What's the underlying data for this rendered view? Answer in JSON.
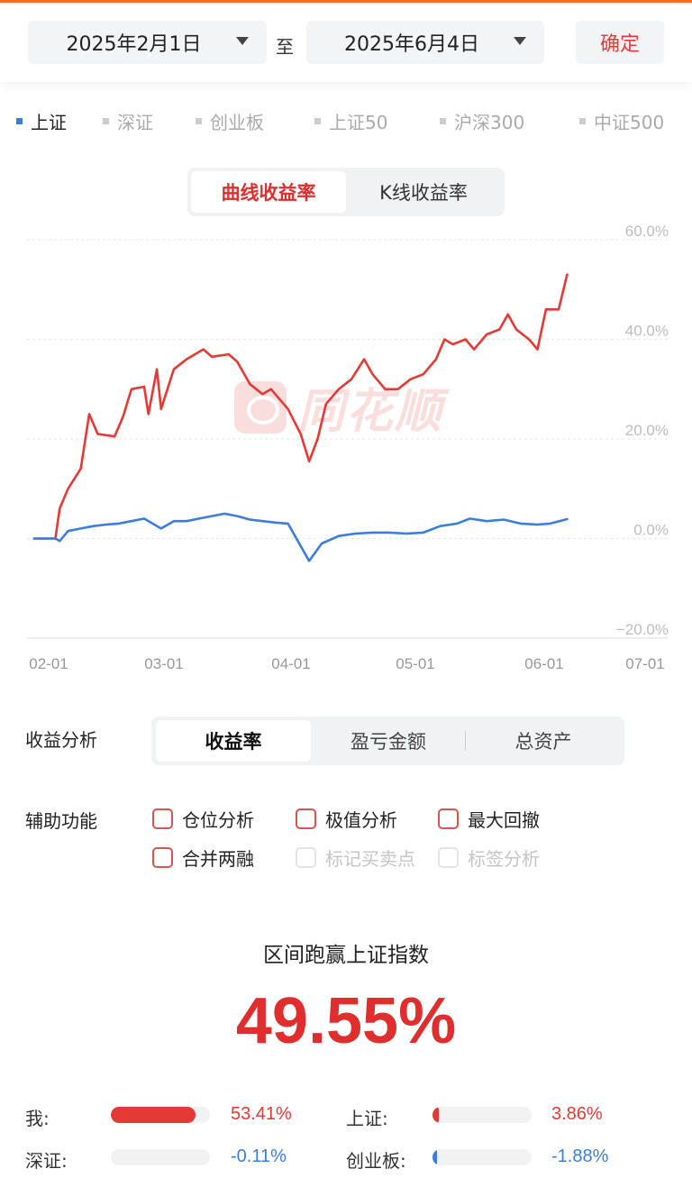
{
  "date_filter": {
    "start_date": "2025年2月1日",
    "separator": "至",
    "end_date": "2025年6月4日",
    "confirm_label": "确定"
  },
  "index_legend": [
    {
      "label": "上证",
      "active": true
    },
    {
      "label": "深证",
      "active": false
    },
    {
      "label": "创业板",
      "active": false
    },
    {
      "label": "上证50",
      "active": false
    },
    {
      "label": "沪深300",
      "active": false
    },
    {
      "label": "中证500",
      "active": false
    }
  ],
  "chart_mode": {
    "options": [
      "曲线收益率",
      "K线收益率"
    ],
    "selected": "曲线收益率"
  },
  "watermark_text": "同花顺",
  "chart_data": {
    "type": "line",
    "x_ticks": [
      "02-01",
      "03-01",
      "04-01",
      "05-01",
      "06-01",
      "07-01"
    ],
    "y_ticks": [
      "60.0%",
      "40.0%",
      "20.0%",
      "0.0%",
      "-20.0%"
    ],
    "ylim": [
      -20,
      60
    ],
    "grid": true,
    "series": [
      {
        "color": "#e53935",
        "points": [
          [
            "2025-02-01",
            0
          ],
          [
            "2025-02-06",
            0
          ],
          [
            "2025-02-07",
            6
          ],
          [
            "2025-02-09",
            10
          ],
          [
            "2025-02-12",
            14
          ],
          [
            "2025-02-14",
            25
          ],
          [
            "2025-02-16",
            21
          ],
          [
            "2025-02-20",
            20.5
          ],
          [
            "2025-02-22",
            24.5
          ],
          [
            "2025-02-24",
            30
          ],
          [
            "2025-02-27",
            30.5
          ],
          [
            "2025-02-28",
            25
          ],
          [
            "2025-03-02",
            34
          ],
          [
            "2025-03-03",
            26
          ],
          [
            "2025-03-06",
            34
          ],
          [
            "2025-03-09",
            36
          ],
          [
            "2025-03-11",
            37
          ],
          [
            "2025-03-13",
            38
          ],
          [
            "2025-03-15",
            36.5
          ],
          [
            "2025-03-19",
            37
          ],
          [
            "2025-03-21",
            35.5
          ],
          [
            "2025-03-24",
            31
          ],
          [
            "2025-03-27",
            29
          ],
          [
            "2025-03-29",
            30
          ],
          [
            "2025-03-31",
            28
          ],
          [
            "2025-04-02",
            26
          ],
          [
            "2025-04-05",
            21
          ],
          [
            "2025-04-07",
            15.5
          ],
          [
            "2025-04-09",
            20
          ],
          [
            "2025-04-11",
            27
          ],
          [
            "2025-04-14",
            30
          ],
          [
            "2025-04-17",
            32
          ],
          [
            "2025-04-20",
            36
          ],
          [
            "2025-04-22",
            33
          ],
          [
            "2025-04-25",
            30
          ],
          [
            "2025-04-28",
            30
          ],
          [
            "2025-05-01",
            32
          ],
          [
            "2025-05-04",
            33
          ],
          [
            "2025-05-07",
            36
          ],
          [
            "2025-05-09",
            40
          ],
          [
            "2025-05-11",
            39
          ],
          [
            "2025-05-14",
            40
          ],
          [
            "2025-05-16",
            38
          ],
          [
            "2025-05-19",
            41
          ],
          [
            "2025-05-22",
            42
          ],
          [
            "2025-05-24",
            45
          ],
          [
            "2025-05-26",
            42
          ],
          [
            "2025-05-29",
            40
          ],
          [
            "2025-05-31",
            38
          ],
          [
            "2025-06-02",
            46
          ],
          [
            "2025-06-05",
            46
          ],
          [
            "2025-06-07",
            53
          ]
        ]
      },
      {
        "color": "#3b7ddd",
        "points": [
          [
            "2025-02-01",
            0
          ],
          [
            "2025-02-06",
            0
          ],
          [
            "2025-02-07",
            -0.5
          ],
          [
            "2025-02-09",
            1.5
          ],
          [
            "2025-02-12",
            2
          ],
          [
            "2025-02-15",
            2.5
          ],
          [
            "2025-02-18",
            2.8
          ],
          [
            "2025-02-21",
            3
          ],
          [
            "2025-02-24",
            3.5
          ],
          [
            "2025-02-27",
            4
          ],
          [
            "2025-03-01",
            3
          ],
          [
            "2025-03-03",
            2
          ],
          [
            "2025-03-06",
            3.5
          ],
          [
            "2025-03-09",
            3.5
          ],
          [
            "2025-03-12",
            4
          ],
          [
            "2025-03-15",
            4.5
          ],
          [
            "2025-03-18",
            5
          ],
          [
            "2025-03-21",
            4.5
          ],
          [
            "2025-03-24",
            3.8
          ],
          [
            "2025-03-27",
            3.5
          ],
          [
            "2025-03-30",
            3.2
          ],
          [
            "2025-04-02",
            3
          ],
          [
            "2025-04-05",
            -1.5
          ],
          [
            "2025-04-07",
            -4.5
          ],
          [
            "2025-04-10",
            -1
          ],
          [
            "2025-04-14",
            0.5
          ],
          [
            "2025-04-18",
            1
          ],
          [
            "2025-04-22",
            1.2
          ],
          [
            "2025-04-26",
            1.2
          ],
          [
            "2025-04-30",
            1
          ],
          [
            "2025-05-04",
            1.2
          ],
          [
            "2025-05-08",
            2.5
          ],
          [
            "2025-05-12",
            3
          ],
          [
            "2025-05-15",
            4
          ],
          [
            "2025-05-19",
            3.5
          ],
          [
            "2025-05-23",
            3.8
          ],
          [
            "2025-05-27",
            3
          ],
          [
            "2025-05-31",
            2.8
          ],
          [
            "2025-06-03",
            3
          ],
          [
            "2025-06-07",
            3.9
          ]
        ]
      }
    ]
  },
  "analysis": {
    "label": "收益分析",
    "tabs": [
      "收益率",
      "盈亏金额",
      "总资产"
    ],
    "selected": "收益率"
  },
  "aux": {
    "label": "辅助功能",
    "options": [
      {
        "label": "仓位分析",
        "enabled": true
      },
      {
        "label": "极值分析",
        "enabled": true
      },
      {
        "label": "最大回撤",
        "enabled": true
      },
      {
        "label": "合并两融",
        "enabled": true
      },
      {
        "label": "标记买卖点",
        "enabled": false
      },
      {
        "label": "标签分析",
        "enabled": false
      }
    ]
  },
  "outperform": {
    "label": "区间跑赢上证指数",
    "value": "49.55%"
  },
  "comparison": [
    {
      "label": "我:",
      "value": "53.41%",
      "fraction": 0.85,
      "color": "#e53935"
    },
    {
      "label": "上证:",
      "value": "3.86%",
      "fraction": 0.06,
      "color": "#e53935"
    },
    {
      "label": "深证:",
      "value": "-0.11%",
      "fraction": 0.0,
      "color": "#3b7ddd"
    },
    {
      "label": "创业板:",
      "value": "-1.88%",
      "fraction": 0.03,
      "color": "#3b7ddd"
    }
  ]
}
